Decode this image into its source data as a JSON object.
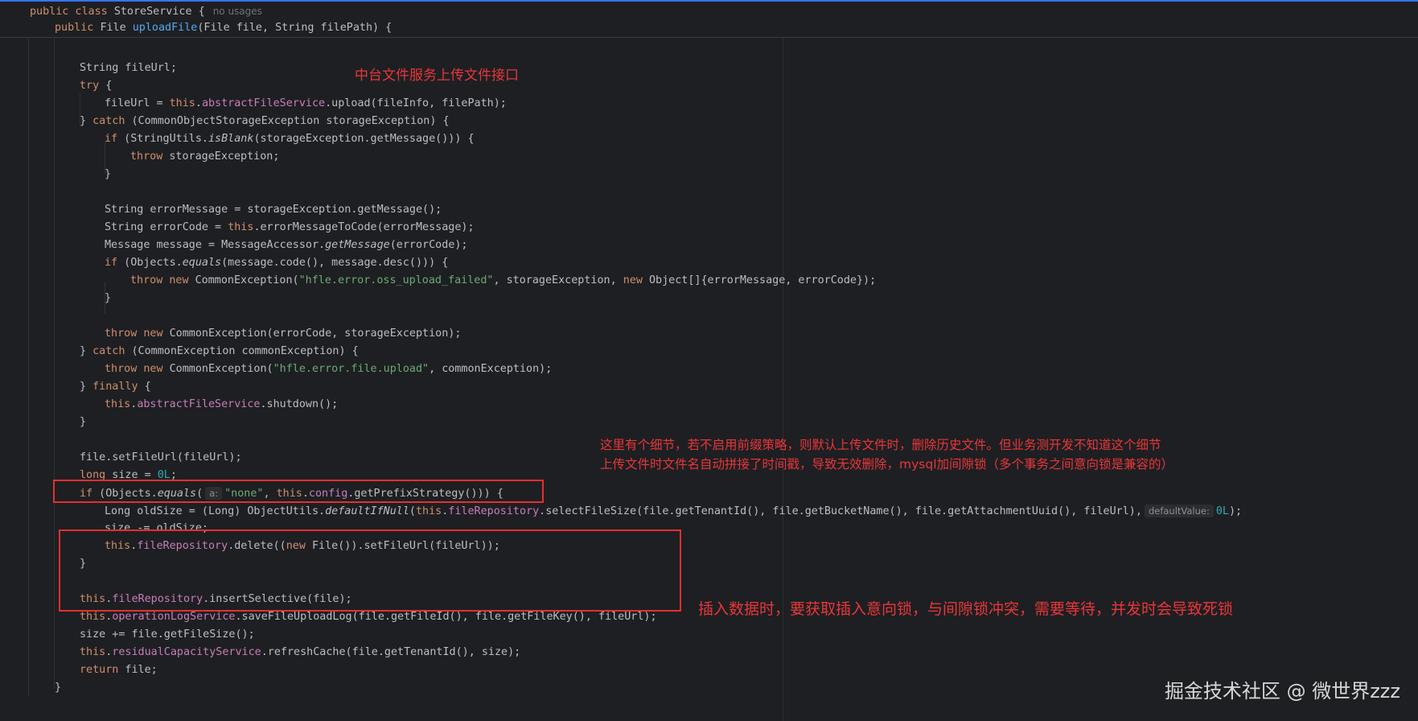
{
  "sticky": {
    "l1": {
      "kw": "public class ",
      "name": "StoreService",
      "brace": " {",
      "usages": "no usages"
    },
    "l2": {
      "kw": "public ",
      "type": "File ",
      "method": "uploadFile",
      "params": "(File file, String filePath) {"
    }
  },
  "code": {
    "l0": "File",
    "l1": "String fileUrl;",
    "l2": {
      "kw": "try",
      "rest": " {"
    },
    "l3": {
      "a": "fileUrl = ",
      "this": "this",
      "dot": ".",
      "fld": "abstractFileService",
      "rest": ".upload(fileInfo, filePath);"
    },
    "l4": {
      "a": "} ",
      "kw": "catch",
      "rest": " (CommonObjectStorageException storageException) {"
    },
    "l5": {
      "kw": "if",
      "a": " (StringUtils.",
      "it": "isBlank",
      "rest": "(storageException.getMessage())) {"
    },
    "l6": {
      "kw": "throw",
      "rest": " storageException;"
    },
    "l7": "}",
    "l8": "String errorMessage = storageException.getMessage();",
    "l9": {
      "a": "String errorCode = ",
      "this": "this",
      "rest": ".errorMessageToCode(errorMessage);"
    },
    "l10": {
      "a": "Message message = MessageAccessor.",
      "it": "getMessage",
      "rest": "(errorCode);"
    },
    "l11": {
      "kw": "if",
      "a": " (Objects.",
      "it": "equals",
      "rest": "(message.code(), message.desc())) {"
    },
    "l12": {
      "kw": "throw new",
      "a": " CommonException(",
      "str": "\"hfle.error.oss_upload_failed\"",
      "b": ", storageException, ",
      "kw2": "new",
      "rest": " Object[]{errorMessage, errorCode});"
    },
    "l13": "}",
    "l14": {
      "kw": "throw new",
      "rest": " CommonException(errorCode, storageException);"
    },
    "l15": {
      "a": "} ",
      "kw": "catch",
      "rest": " (CommonException commonException) {"
    },
    "l16": {
      "kw": "throw new",
      "a": " CommonException(",
      "str": "\"hfle.error.file.upload\"",
      "rest": ", commonException);"
    },
    "l17": {
      "a": "} ",
      "kw": "finally",
      "rest": " {"
    },
    "l18": {
      "this": "this",
      "dot": ".",
      "fld": "abstractFileService",
      "rest": ".shutdown();"
    },
    "l19": "}",
    "l20": "file.setFileUrl(fileUrl);",
    "l21": {
      "kw": "long",
      "a": " size = ",
      "num": "0L",
      "rest": ";"
    },
    "l22": {
      "kw": "if",
      "a": " (Objects.",
      "it": "equals",
      "b": "(",
      "hint": "a:",
      "str": "\"none\"",
      "c": ", ",
      "this": "this",
      "dot": ".",
      "fld": "config",
      "rest": ".getPrefixStrategy())) {"
    },
    "l23": {
      "a": "Long oldSize = (Long) ObjectUtils.",
      "it": "defaultIfNull",
      "b": "(",
      "this": "this",
      "dot": ".",
      "fld": "fileRepository",
      "c": ".selectFileSize(file.getTenantId(), file.getBucketName(), file.getAttachmentUuid(), fileUrl),",
      "hint": "defaultValue:",
      "num": "0L",
      "rest": ");"
    },
    "l24": "size -= oldSize;",
    "l25": {
      "this": "this",
      "dot": ".",
      "fld": "fileRepository",
      "a": ".delete((",
      "kw": "new",
      "rest": " File()).setFileUrl(fileUrl));"
    },
    "l26": "}",
    "l27": {
      "this": "this",
      "dot": ".",
      "fld": "fileRepository",
      "rest": ".insertSelective(file);"
    },
    "l28": {
      "this": "this",
      "dot": ".",
      "fld": "operationLogService",
      "rest": ".saveFileUploadLog(file.getFileId(), file.getFileKey(), fileUrl);"
    },
    "l29": "size += file.getFileSize();",
    "l30": {
      "this": "this",
      "dot": ".",
      "fld": "residualCapacityService",
      "rest": ".refreshCache(file.getTenantId(), size);"
    },
    "l31": {
      "kw": "return",
      "rest": " file;"
    },
    "l32": "}"
  },
  "annotations": {
    "note1": "中台文件服务上传文件接口",
    "note2_line1": "这里有个细节，若不启用前缀策略，则默认上传文件时，删除历史文件。但业务测开发不知道这个细节",
    "note2_line2": "上传文件时文件名自动拼接了时间戳，导致无效删除，mysql加间隙锁（多个事务之间意向锁是兼容的）",
    "note3": "插入数据时，要获取插入意向锁，与间隙锁冲突，需要等待，并发时会导致死锁"
  },
  "watermark": "掘金技术社区 @ 微世界zzz",
  "colors": {
    "annotation": "#e8363a",
    "keyword": "#cf8e6d",
    "field": "#c77dbb",
    "string": "#6aab73",
    "number": "#2aacb8",
    "background": "#1e1f22"
  }
}
